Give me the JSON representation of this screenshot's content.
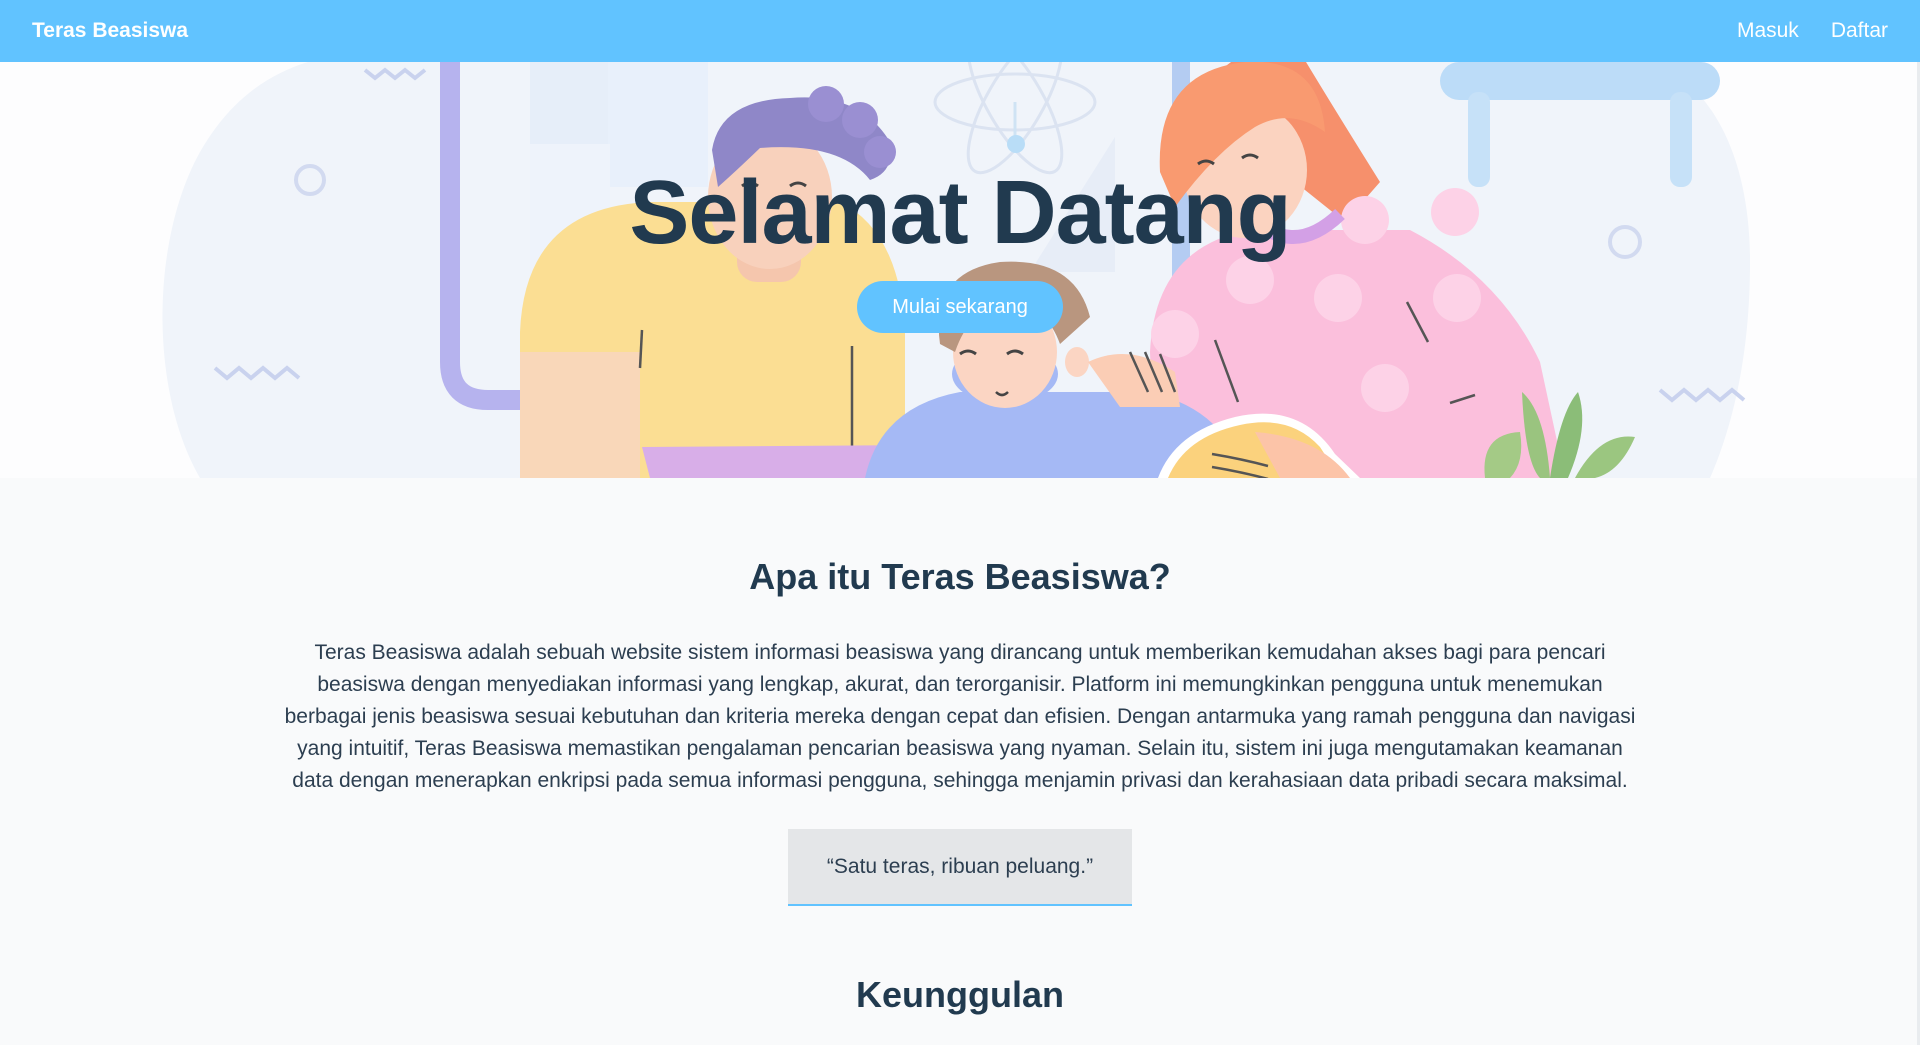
{
  "navbar": {
    "brand": "Teras Beasiswa",
    "links": [
      "Masuk",
      "Daftar"
    ]
  },
  "hero": {
    "title": "Selamat Datang",
    "cta_label": "Mulai sekarang",
    "illustration": "family-studying-illustration"
  },
  "about": {
    "title": "Apa itu Teras Beasiswa?",
    "description": "Teras Beasiswa adalah sebuah website sistem informasi beasiswa yang dirancang untuk memberikan kemudahan akses bagi para pencari beasiswa dengan menyediakan informasi yang lengkap, akurat, dan terorganisir. Platform ini memungkinkan pengguna untuk menemukan berbagai jenis beasiswa sesuai kebutuhan dan kriteria mereka dengan cepat dan efisien. Dengan antarmuka yang ramah pengguna dan navigasi yang intuitif, Teras Beasiswa memastikan pengalaman pencarian beasiswa yang nyaman. Selain itu, sistem ini juga mengutamakan keamanan data dengan menerapkan enkripsi pada semua informasi pengguna, sehingga menjamin privasi dan kerahasiaan data pribadi secara maksimal.",
    "quote": "“Satu teras, ribuan peluang.”"
  },
  "advantages": {
    "title": "Keunggulan"
  },
  "colors": {
    "primary": "#61c3ff",
    "heading": "#213a4f",
    "background": "#f9fafb",
    "quote_bg": "#e4e6e8"
  }
}
